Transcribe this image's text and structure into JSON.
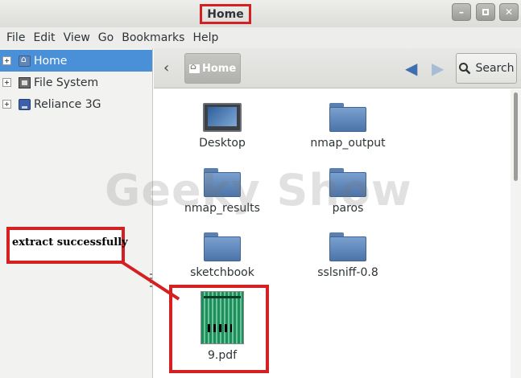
{
  "window": {
    "title": "Home",
    "controls": [
      "minimize",
      "maximize",
      "close"
    ]
  },
  "menubar": {
    "items": [
      "File",
      "Edit",
      "View",
      "Go",
      "Bookmarks",
      "Help"
    ]
  },
  "sidebar": {
    "items": [
      {
        "label": "Home",
        "icon": "home-folder-icon",
        "selected": true
      },
      {
        "label": "File System",
        "icon": "file-system-icon",
        "selected": false
      },
      {
        "label": "Reliance 3G",
        "icon": "network-drive-icon",
        "selected": false
      }
    ]
  },
  "toolbar": {
    "path_label": "Home",
    "search_label": "Search"
  },
  "files": [
    {
      "name": "Desktop",
      "icon": "desktop-icon"
    },
    {
      "name": "nmap_output",
      "icon": "folder-icon"
    },
    {
      "name": "nmap_results",
      "icon": "folder-icon"
    },
    {
      "name": "paros",
      "icon": "folder-icon"
    },
    {
      "name": "sketchbook",
      "icon": "folder-icon"
    },
    {
      "name": "sslsniff-0.8",
      "icon": "folder-icon"
    },
    {
      "name": "9.pdf",
      "icon": "pdf-thumbnail"
    }
  ],
  "watermark": "Geeky Show",
  "annotation": {
    "label": "extract successfully",
    "color": "#d42020"
  },
  "colors": {
    "selection": "#4a90d9",
    "folder": "#5a7fb0",
    "annotation": "#d42020"
  }
}
